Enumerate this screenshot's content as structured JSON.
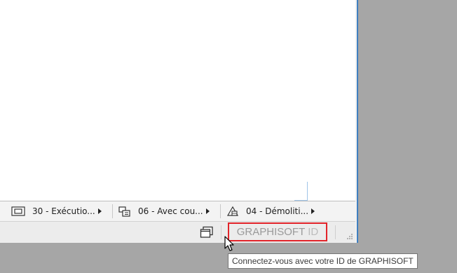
{
  "quick_options": [
    {
      "label": "30 - Exécutio...",
      "icon": "layer-combination-icon"
    },
    {
      "label": "06 - Avec cou...",
      "icon": "model-view-options-icon"
    },
    {
      "label": "04 - Démoliti...",
      "icon": "renovation-filter-icon"
    }
  ],
  "status_bar": {
    "window_icon": "window-toggle-icon",
    "graphisoft_id": {
      "brand": "GRAPHISOFT",
      "id": "ID"
    },
    "resize_icon": "resize-grip-icon"
  },
  "tooltip": {
    "text": "Connectez-vous avec votre ID de GRAPHISOFT"
  },
  "colors": {
    "highlight_border": "#e2242a",
    "window_edge": "#3f7fc0",
    "desktop_bg": "#a6a6a6"
  }
}
